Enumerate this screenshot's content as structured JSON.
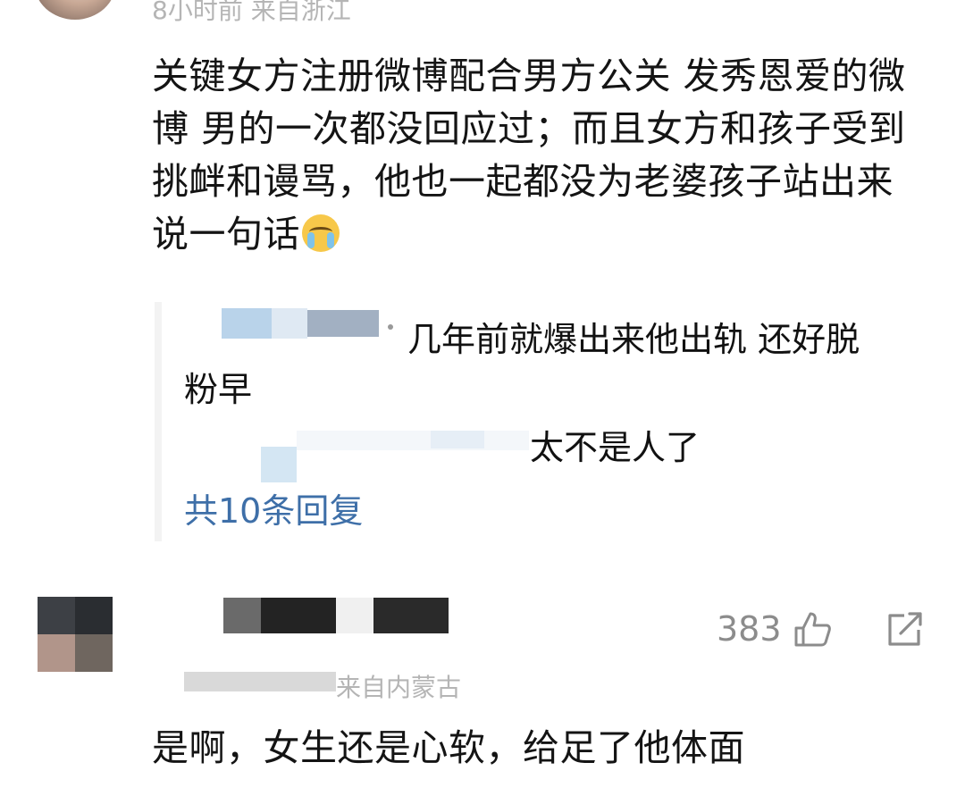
{
  "comment1": {
    "meta": "8小时前  来自浙江",
    "text": "关键女方注册微博配合男方公关 发秀恩爱的微博 男的一次都没回应过；而且女方和孩子受到挑衅和谩骂，他也一起都没为老婆孩子站出来说一句话",
    "emoji": "crying-face"
  },
  "replies": {
    "items": [
      {
        "text_line1": "几年前就爆出来他出轨 还好脱",
        "text_line2": "粉早"
      },
      {
        "text": "太不是人了"
      }
    ],
    "more_label": "共10条回复",
    "link_color": "#3e6fa8"
  },
  "comment2": {
    "likes": "383",
    "meta": "来自内蒙古",
    "text": "是啊，女生还是心软，给足了他体面"
  },
  "icons": [
    "thumbs-up-icon",
    "share-icon",
    "crying-face-emoji"
  ]
}
